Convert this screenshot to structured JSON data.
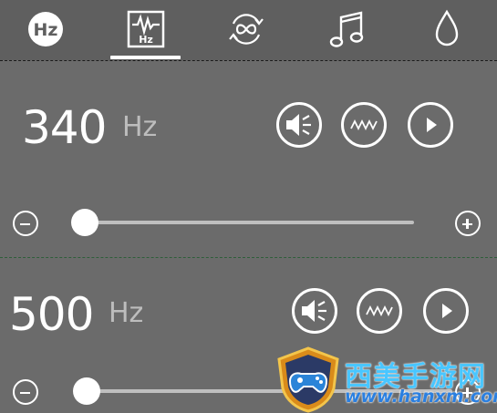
{
  "tabs": [
    {
      "name": "hz-logo-icon",
      "label": "Hz",
      "selected": false
    },
    {
      "name": "waveform-hz-icon",
      "label": "Hz",
      "selected": true
    },
    {
      "name": "infinity-loop-icon",
      "selected": false
    },
    {
      "name": "music-note-icon",
      "selected": false
    },
    {
      "name": "water-drop-icon",
      "selected": false
    }
  ],
  "tones": [
    {
      "frequency": "340",
      "unit": "Hz",
      "slider_level": 0.03
    },
    {
      "frequency": "500",
      "unit": "Hz",
      "slider_level": 0.03
    }
  ],
  "watermark": {
    "text_cn": "西美手游网",
    "url": "www.hanxm.com"
  },
  "colors": {
    "background": "#6b6b6b",
    "tabbar": "#5f5f5f",
    "accent_white": "#ffffff",
    "unit_gray": "#bdbdbd",
    "track": "#bfbfbf"
  }
}
